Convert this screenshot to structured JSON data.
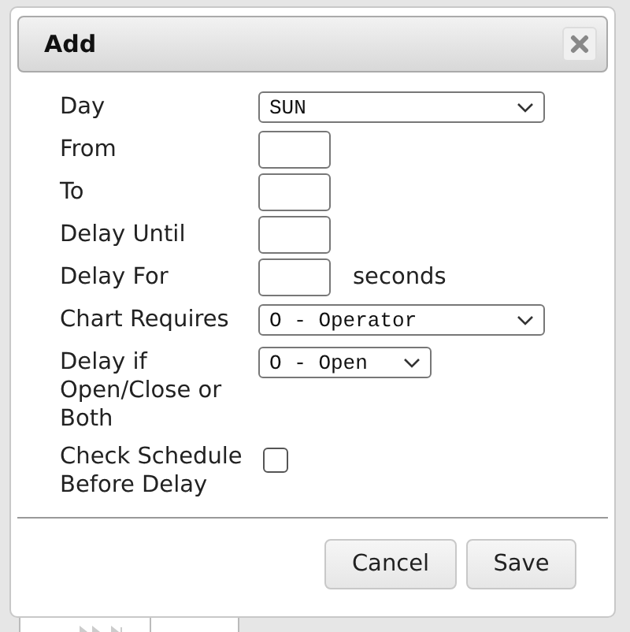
{
  "dialog": {
    "title": "Add",
    "fields": [
      {
        "kind": "select",
        "label": "Day",
        "value": "SUN",
        "wide": true
      },
      {
        "kind": "text",
        "label": "From"
      },
      {
        "kind": "text",
        "label": "To"
      },
      {
        "kind": "text",
        "label": "Delay Until"
      },
      {
        "kind": "text",
        "label": "Delay For",
        "suffix": "seconds"
      },
      {
        "kind": "select",
        "label": "Chart Requires",
        "value": "O - Operator",
        "wide": true
      },
      {
        "kind": "select",
        "label": "Delay if Open/Close or Both",
        "value": "O - Open",
        "wide": false
      },
      {
        "kind": "checkbox",
        "label": "Check Schedule Before Delay",
        "checked": false
      }
    ],
    "buttons": [
      "Cancel",
      "Save"
    ]
  }
}
